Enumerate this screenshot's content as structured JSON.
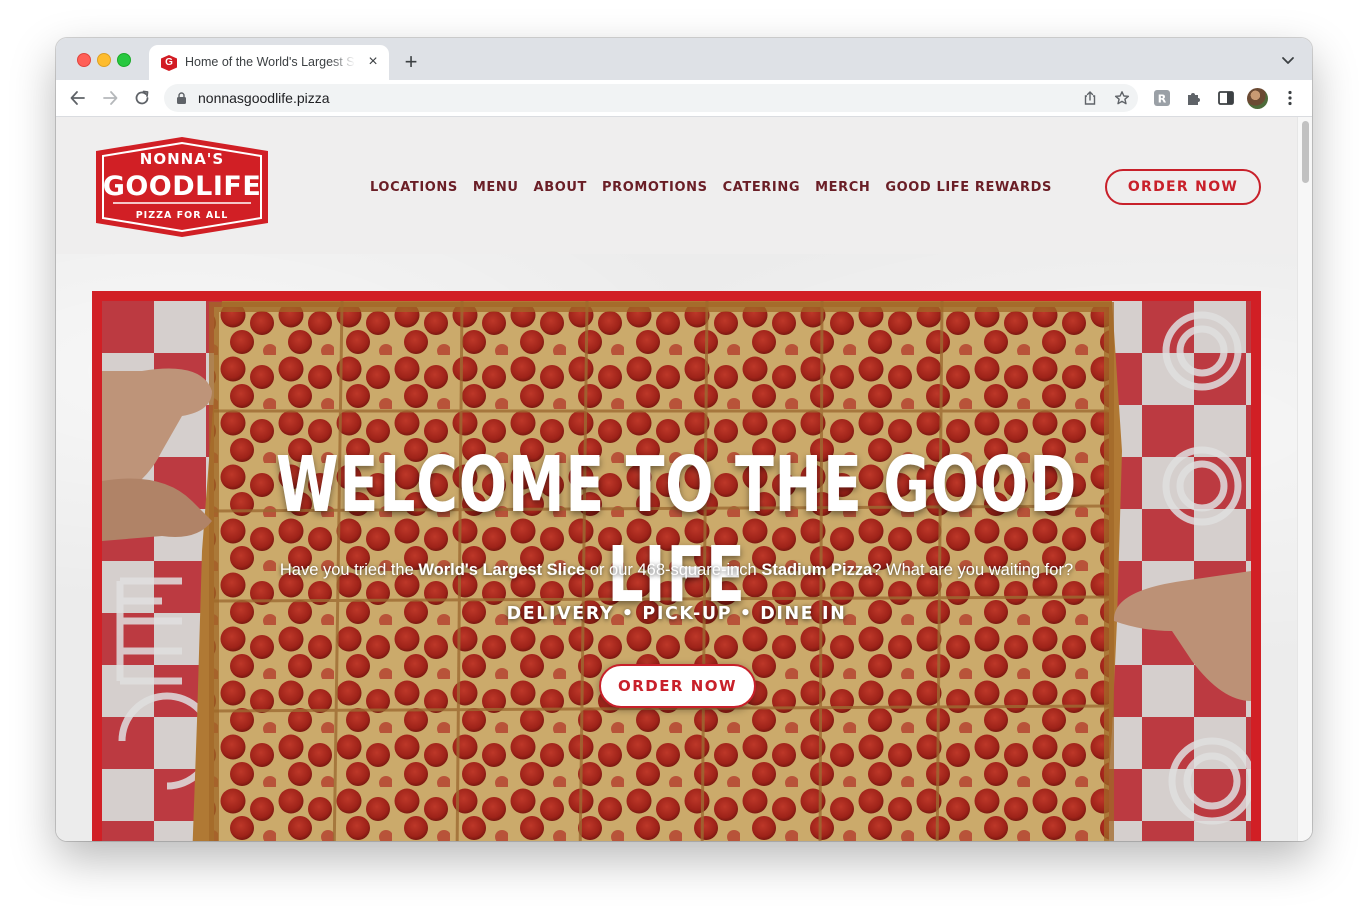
{
  "browser": {
    "tab_title": "Home of the World's Largest Slice",
    "tab_close": "×",
    "new_tab": "+",
    "url": "nonnasgoodlife.pizza",
    "favicon_letter": "G"
  },
  "header": {
    "logo": {
      "line1": "NONNA'S",
      "line2": "GOODLIFE",
      "line3": "PIZZA FOR ALL"
    },
    "nav": [
      "LOCATIONS",
      "MENU",
      "ABOUT",
      "PROMOTIONS",
      "CATERING",
      "MERCH",
      "GOOD LIFE REWARDS"
    ],
    "order_button": "ORDER NOW"
  },
  "hero": {
    "title": "WELCOME TO THE GOOD LIFE",
    "subtitle_parts": [
      "Have you tried the ",
      "World's Largest Slice",
      " or our 468-square-inch ",
      "Stadium Pizza",
      "? What are you waiting for?"
    ],
    "modes": "DELIVERY • PICK-UP • DINE IN",
    "order_button": "ORDER NOW"
  },
  "colors": {
    "brand_red": "#c8202a",
    "nav_text": "#6a1e26",
    "page_bg": "#efeeee"
  },
  "icons": [
    "back-arrow-icon",
    "forward-arrow-icon",
    "reload-icon",
    "lock-icon",
    "share-icon",
    "bookmark-star-icon",
    "extension-icon",
    "puzzle-icon",
    "side-panel-icon",
    "profile-avatar",
    "menu-kebab-icon",
    "tab-search-chevron-icon"
  ]
}
